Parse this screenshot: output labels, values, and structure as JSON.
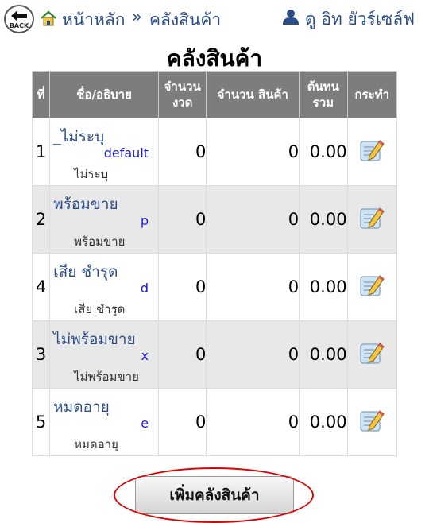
{
  "nav": {
    "back_label": "BACK",
    "home_label": "หน้าหลัก",
    "separator": "»",
    "current_label": "คลังสินค้า",
    "user_name": "ดู อิท ยัวร์เซล์ฟ"
  },
  "page_title": "คลังสินค้า",
  "table": {
    "headers": {
      "no": "ที่",
      "name": "ชื่อ/อธิบาย",
      "lots_l1": "จำนวน",
      "lots_l2": "งวด",
      "qty": "จำนวน สินค้า",
      "cost_l1": "ต้นทน",
      "cost_l2": "รวม",
      "action": "กระทำ"
    },
    "rows": [
      {
        "no": "1",
        "name": "_ไม่ระบุ",
        "code": "default",
        "desc": "ไม่ระบุ",
        "lots": "0",
        "qty": "0",
        "cost": "0.00"
      },
      {
        "no": "2",
        "name": "พร้อมขาย",
        "code": "p",
        "desc": "พร้อมขาย",
        "lots": "0",
        "qty": "0",
        "cost": "0.00"
      },
      {
        "no": "4",
        "name": "เสีย ชำรุด",
        "code": "d",
        "desc": "เสีย ชำรุด",
        "lots": "0",
        "qty": "0",
        "cost": "0.00"
      },
      {
        "no": "3",
        "name": "ไม่พร้อมขาย",
        "code": "x",
        "desc": "ไม่พร้อมขาย",
        "lots": "0",
        "qty": "0",
        "cost": "0.00"
      },
      {
        "no": "5",
        "name": "หมดอายุ",
        "code": "e",
        "desc": "หมดอายุ",
        "lots": "0",
        "qty": "0",
        "cost": "0.00"
      }
    ]
  },
  "add_button_label": "เพิ่มคลังสินค้า",
  "colors": {
    "header_bg": "#7d7d7d",
    "link": "#2a4d8a",
    "code": "#1a1ad8",
    "alt_row": "#e8e8e8",
    "highlight": "#e10000"
  }
}
